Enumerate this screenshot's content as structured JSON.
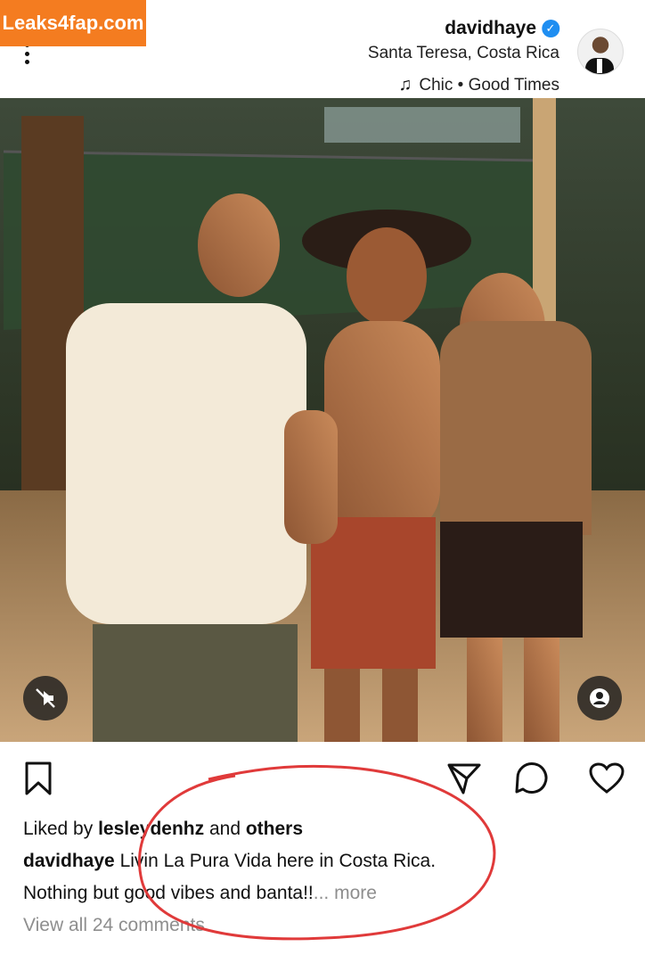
{
  "header": {
    "username": "davidhaye",
    "verified_mark": "✓",
    "location": "Santa Teresa, Costa Rica",
    "music_icon": "music-note-icon",
    "music_track": "Chic • Good Times"
  },
  "watermark": "Leaks4fap.com",
  "actions": {
    "like_icon": "heart-icon",
    "comment_icon": "comment-icon",
    "share_icon": "paper-plane-icon",
    "save_icon": "bookmark-icon"
  },
  "caption": {
    "liked_prefix": "Liked by",
    "liked_user": "lesleydenhz",
    "liked_and": "and",
    "liked_others": "others",
    "author": "davidhaye",
    "text_line1": "Livin La Pura Vida here in Costa Rica.",
    "text_line2": "Nothing but good vibes and banta!!",
    "more": "... more",
    "view_comments": "View all 24 comments"
  },
  "colors": {
    "accent_blue": "#1f8ef1",
    "annotation_red": "#e03a3a",
    "watermark_orange": "#f47c20"
  }
}
